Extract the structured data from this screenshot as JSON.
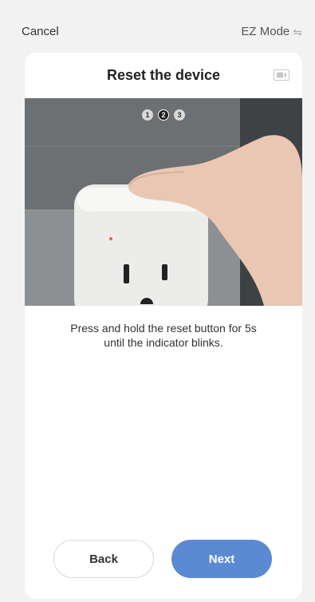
{
  "header": {
    "cancel_label": "Cancel",
    "mode_label": "EZ Mode",
    "mode_icon": "swap-icon"
  },
  "card": {
    "title": "Reset the device",
    "video_icon": "video-icon",
    "steps": [
      "1",
      "2",
      "3"
    ],
    "active_step": 2,
    "instruction_line1": "Press and hold the reset button for 5s",
    "instruction_line2": "until the indicator blinks."
  },
  "footer": {
    "back_label": "Back",
    "next_label": "Next"
  }
}
